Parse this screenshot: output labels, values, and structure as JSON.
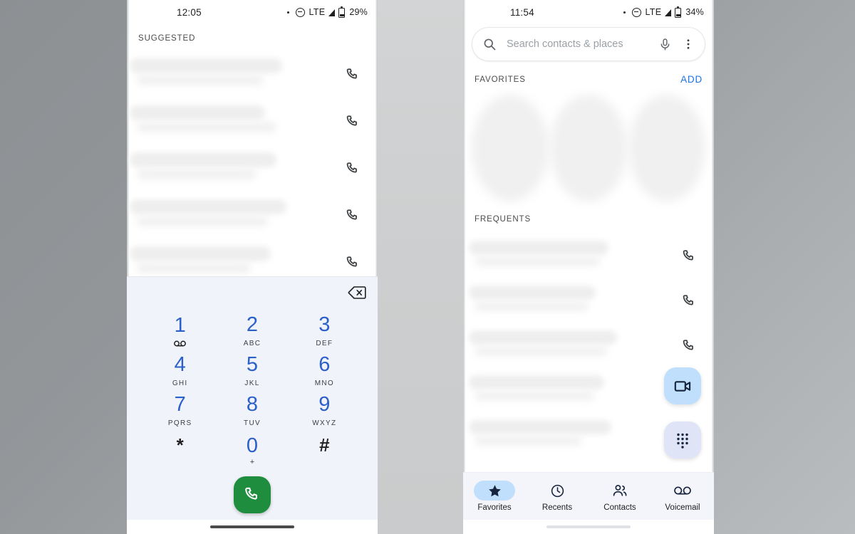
{
  "background": {
    "color_start": "#8d9093",
    "color_end": "#b9bdbf",
    "gap_color": "#cccecf"
  },
  "colors": {
    "dial_digit_blue": "#2b5fc9",
    "call_green": "#1e8e3e",
    "add_link_blue": "#1a73e8",
    "fab_video_bg": "#bfdffc",
    "fab_dialpad_bg": "#dfe4f7",
    "nav_active_pill": "#bfdffc",
    "dialpad_bg": "#f1f3fa"
  },
  "left_phone": {
    "status_bar": {
      "time": "12:05",
      "network": "LTE",
      "battery_percent": "29%",
      "icons": [
        "dot-icon",
        "do-not-disturb-icon",
        "signal-icon",
        "battery-icon"
      ]
    },
    "suggested": {
      "header": "SUGGESTED",
      "rows": [
        {
          "name": "",
          "subtitle": "",
          "action_icon": "phone-call-icon"
        },
        {
          "name": "",
          "subtitle": "",
          "action_icon": "phone-call-icon"
        },
        {
          "name": "",
          "subtitle": "",
          "action_icon": "phone-call-icon"
        },
        {
          "name": "",
          "subtitle": "",
          "action_icon": "phone-call-icon"
        },
        {
          "name": "",
          "subtitle": "",
          "action_icon": "phone-call-icon"
        }
      ]
    },
    "dialpad": {
      "entry_value": "",
      "backspace_icon": "backspace-icon",
      "keys": [
        {
          "digit": "1",
          "sub": "",
          "glyph": "voicemail-icon"
        },
        {
          "digit": "2",
          "sub": "ABC",
          "glyph": ""
        },
        {
          "digit": "3",
          "sub": "DEF",
          "glyph": ""
        },
        {
          "digit": "4",
          "sub": "GHI",
          "glyph": ""
        },
        {
          "digit": "5",
          "sub": "JKL",
          "glyph": ""
        },
        {
          "digit": "6",
          "sub": "MNO",
          "glyph": ""
        },
        {
          "digit": "7",
          "sub": "PQRS",
          "glyph": ""
        },
        {
          "digit": "8",
          "sub": "TUV",
          "glyph": ""
        },
        {
          "digit": "9",
          "sub": "WXYZ",
          "glyph": ""
        },
        {
          "digit": "*",
          "sub": "",
          "glyph": ""
        },
        {
          "digit": "0",
          "sub": "+",
          "glyph": ""
        },
        {
          "digit": "#",
          "sub": "",
          "glyph": ""
        }
      ],
      "call_button_icon": "phone-call-icon"
    }
  },
  "right_phone": {
    "status_bar": {
      "time": "11:54",
      "network": "LTE",
      "battery_percent": "34%",
      "icons": [
        "dot-icon",
        "do-not-disturb-icon",
        "signal-icon",
        "battery-icon"
      ]
    },
    "search": {
      "placeholder": "Search contacts & places",
      "search_icon": "search-icon",
      "mic_icon": "microphone-icon",
      "overflow_icon": "more-vert-icon"
    },
    "favorites": {
      "header": "FAVORITES",
      "add_label": "ADD",
      "avatars": [
        {
          "name": ""
        },
        {
          "name": ""
        },
        {
          "name": ""
        }
      ]
    },
    "frequents": {
      "header": "FREQUENTS",
      "rows": [
        {
          "name": "",
          "subtitle": "",
          "action_icon": "phone-call-icon"
        },
        {
          "name": "",
          "subtitle": "",
          "action_icon": "phone-call-icon"
        },
        {
          "name": "",
          "subtitle": "",
          "action_icon": "phone-call-icon"
        },
        {
          "name": "",
          "subtitle": "",
          "action_icon": "phone-call-icon"
        },
        {
          "name": "",
          "subtitle": "",
          "action_icon": "phone-call-icon"
        }
      ]
    },
    "fabs": [
      {
        "name": "video-call-fab",
        "icon": "video-camera-icon"
      },
      {
        "name": "dialpad-fab",
        "icon": "dialpad-icon"
      }
    ],
    "bottom_nav": {
      "items": [
        {
          "label": "Favorites",
          "icon": "star-icon",
          "active": true
        },
        {
          "label": "Recents",
          "icon": "clock-icon",
          "active": false
        },
        {
          "label": "Contacts",
          "icon": "people-icon",
          "active": false
        },
        {
          "label": "Voicemail",
          "icon": "voicemail-icon",
          "active": false
        }
      ]
    }
  }
}
